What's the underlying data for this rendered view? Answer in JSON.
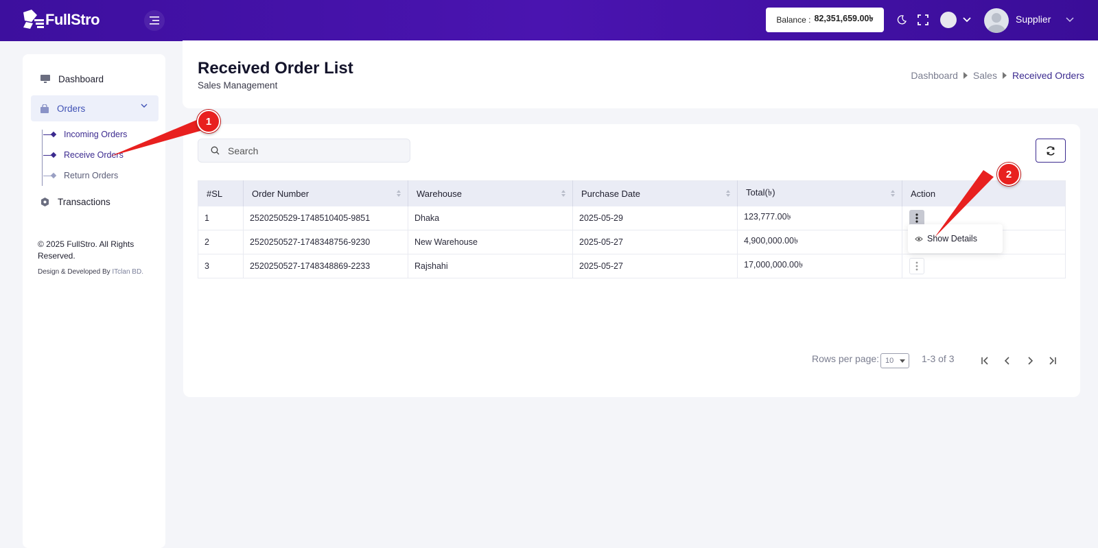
{
  "brand": {
    "name": "FullStro"
  },
  "topbar": {
    "balance_label": "Balance :",
    "balance_value": "82,351,659.00৳",
    "user_name": "Supplier"
  },
  "sidebar": {
    "items": [
      {
        "label": "Dashboard",
        "icon": "monitor-icon"
      },
      {
        "label": "Orders",
        "icon": "bag-icon",
        "active": true
      },
      {
        "label": "Transactions",
        "icon": "coin-icon"
      }
    ],
    "sub_items": [
      {
        "label": "Incoming Orders"
      },
      {
        "label": "Receive Orders"
      },
      {
        "label": "Return Orders"
      }
    ],
    "copyright": "© 2025 FullStro. All Rights Reserved.",
    "credit_prefix": "Design & Developed By",
    "credit_company": "ITclan BD."
  },
  "header": {
    "title": "Received Order List",
    "subtitle": "Sales Management",
    "breadcrumb": [
      "Dashboard",
      "Sales",
      "Received Orders"
    ]
  },
  "search": {
    "placeholder": "Search"
  },
  "table": {
    "columns": [
      "#SL",
      "Order Number",
      "Warehouse",
      "Purchase Date",
      "Total(৳)",
      "Action"
    ],
    "rows": [
      {
        "sl": "1",
        "order_number": "2520250529-1748510405-9851",
        "warehouse": "Dhaka",
        "purchase_date": "2025-05-29",
        "total": "123,777.00৳"
      },
      {
        "sl": "2",
        "order_number": "2520250527-1748348756-9230",
        "warehouse": "New Warehouse",
        "purchase_date": "2025-05-27",
        "total": "4,900,000.00৳"
      },
      {
        "sl": "3",
        "order_number": "2520250527-1748348869-2233",
        "warehouse": "Rajshahi",
        "purchase_date": "2025-05-27",
        "total": "17,000,000.00৳"
      }
    ]
  },
  "dropdown": {
    "show_details": "Show Details"
  },
  "pagination": {
    "rows_per_page_label": "Rows per page:",
    "rows_per_page_value": "10",
    "range": "1-3 of 3"
  },
  "annotations": {
    "callout_1": "1",
    "callout_2": "2"
  },
  "colors": {
    "topbar": "#4a14b0",
    "accent": "#3b2a8f",
    "callout": "#e8201f"
  }
}
